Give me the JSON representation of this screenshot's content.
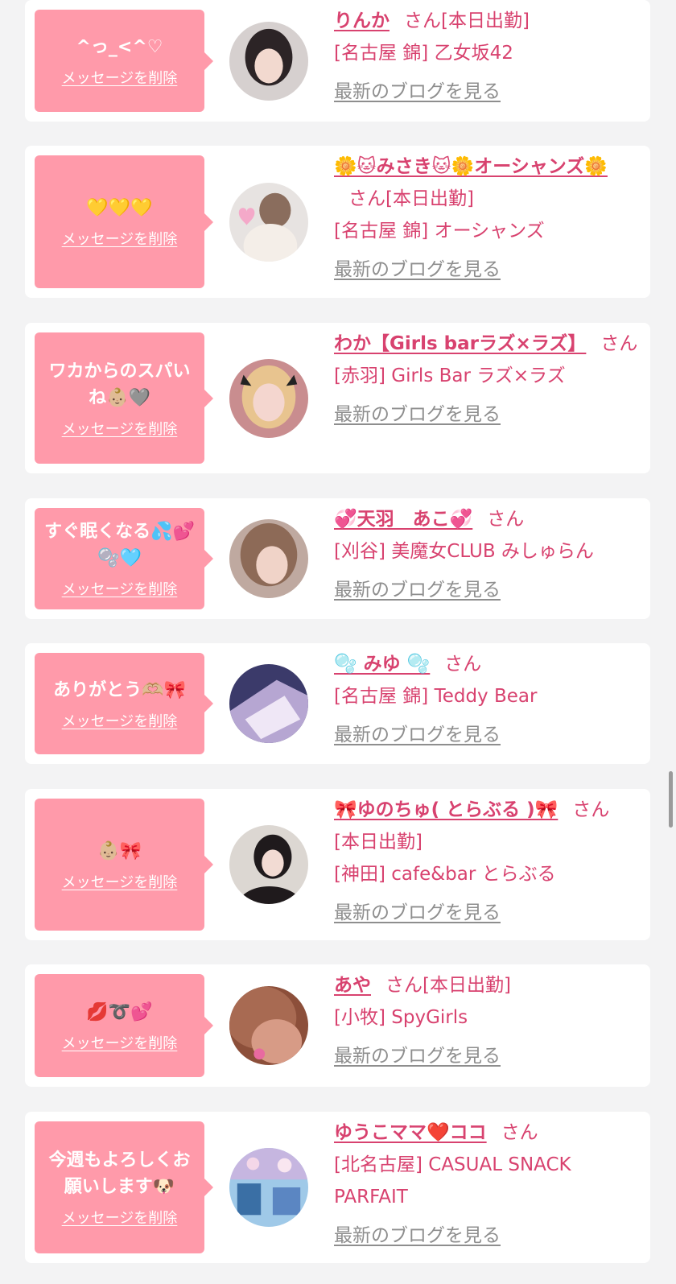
{
  "cards": [
    {
      "message": "^っ_<^♡",
      "delete_label": "メッセージを削除",
      "name": "りんか",
      "san": "さん",
      "status": "[本日出勤]",
      "shop": "[名古屋 錦] 乙女坂42",
      "blog": "最新のブログを見る",
      "avatar_colors": [
        "#d6d0cf",
        "#2c2426",
        "#f2d9cf"
      ]
    },
    {
      "message": "💛💛💛",
      "delete_label": "メッセージを削除",
      "name": "🌼🐱みさき🐱🌼オーシャンズ🌼",
      "san": "さん",
      "status": "[本日出勤]",
      "shop": "[名古屋 錦] オーシャンズ",
      "blog": "最新のブログを見る",
      "avatar_colors": [
        "#e7e3e1",
        "#8a6d5d",
        "#f4a9c9"
      ]
    },
    {
      "message": "ワカからのスパいね👶🏼🩶",
      "delete_label": "メッセージを削除",
      "name": "わか【Girls barラズ×ラズ】",
      "san": "さん",
      "status": "",
      "shop": "[赤羽] Girls Bar ラズ×ラズ",
      "blog": "最新のブログを見る",
      "avatar_colors": [
        "#c98d8f",
        "#e8c48f",
        "#f4d6cf"
      ]
    },
    {
      "message": "すぐ眠くなる💦💕🫧🩵",
      "delete_label": "メッセージを削除",
      "name": "💞天羽　あこ💞",
      "san": "さん",
      "status": "",
      "shop": "[刈谷] 美魔女CLUB みしゅらん",
      "blog": "最新のブログを見る",
      "avatar_colors": [
        "#bfa9a0",
        "#8d6a57",
        "#f0d3c8"
      ]
    },
    {
      "message": "ありがとう🫶🏼🎀",
      "delete_label": "メッセージを削除",
      "name": "🫧 みゆ 🫧",
      "san": "さん",
      "status": "",
      "shop": "[名古屋 錦] Teddy Bear",
      "blog": "最新のブログを見る",
      "avatar_colors": [
        "#3b3a6a",
        "#b6a6d2",
        "#efe7f6"
      ]
    },
    {
      "message": "👶🏼🎀",
      "delete_label": "メッセージを削除",
      "name": "🎀ゆのちゅ( とらぶる )🎀",
      "san": "さん",
      "status": "[本日出勤]",
      "shop": "[神田] cafe&bar とらぶる",
      "blog": "最新のブログを見る",
      "avatar_colors": [
        "#dcd7d2",
        "#1f1a1c",
        "#f2dbd3"
      ]
    },
    {
      "message": "💋➰💕",
      "delete_label": "メッセージを削除",
      "name": "あや",
      "san": "さん",
      "status": "[本日出勤]",
      "shop": "[小牧] SpyGirls",
      "blog": "最新のブログを見る",
      "avatar_colors": [
        "#8c4f3a",
        "#d79b86",
        "#e86aa0"
      ]
    },
    {
      "message": "今週もよろしくお願いします🐶",
      "delete_label": "メッセージを削除",
      "name": "ゆうこママ❤️ココ",
      "san": "さん",
      "status": "",
      "shop": "[北名古屋] CASUAL SNACK PARFAIT",
      "blog": "最新のブログを見る",
      "avatar_colors": [
        "#3a6fa5",
        "#c6b6e0",
        "#9fc9e8"
      ]
    }
  ]
}
